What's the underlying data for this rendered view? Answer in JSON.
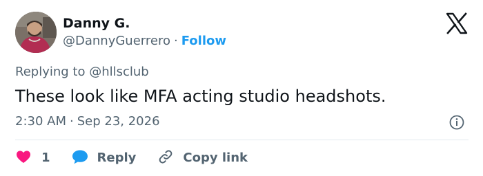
{
  "tweet": {
    "author_name": "Danny G.",
    "author_handle": "@DannyGuerrero",
    "separator": "·",
    "follow_label": "Follow",
    "replying_to": "Replying to @hllsclub",
    "text": "These look like MFA acting studio headshots.",
    "time": "2:30 AM",
    "date": "Sep 23, 2026"
  },
  "actions": {
    "like_count": "1",
    "reply_label": "Reply",
    "copy_label": "Copy link"
  },
  "colors": {
    "accent": "#1d9bf0",
    "like": "#f91880",
    "muted": "#536471",
    "text": "#0f1419"
  },
  "icons": [
    "avatar",
    "x-logo-icon",
    "info-icon",
    "heart-icon",
    "speech-bubble-icon",
    "link-icon"
  ]
}
